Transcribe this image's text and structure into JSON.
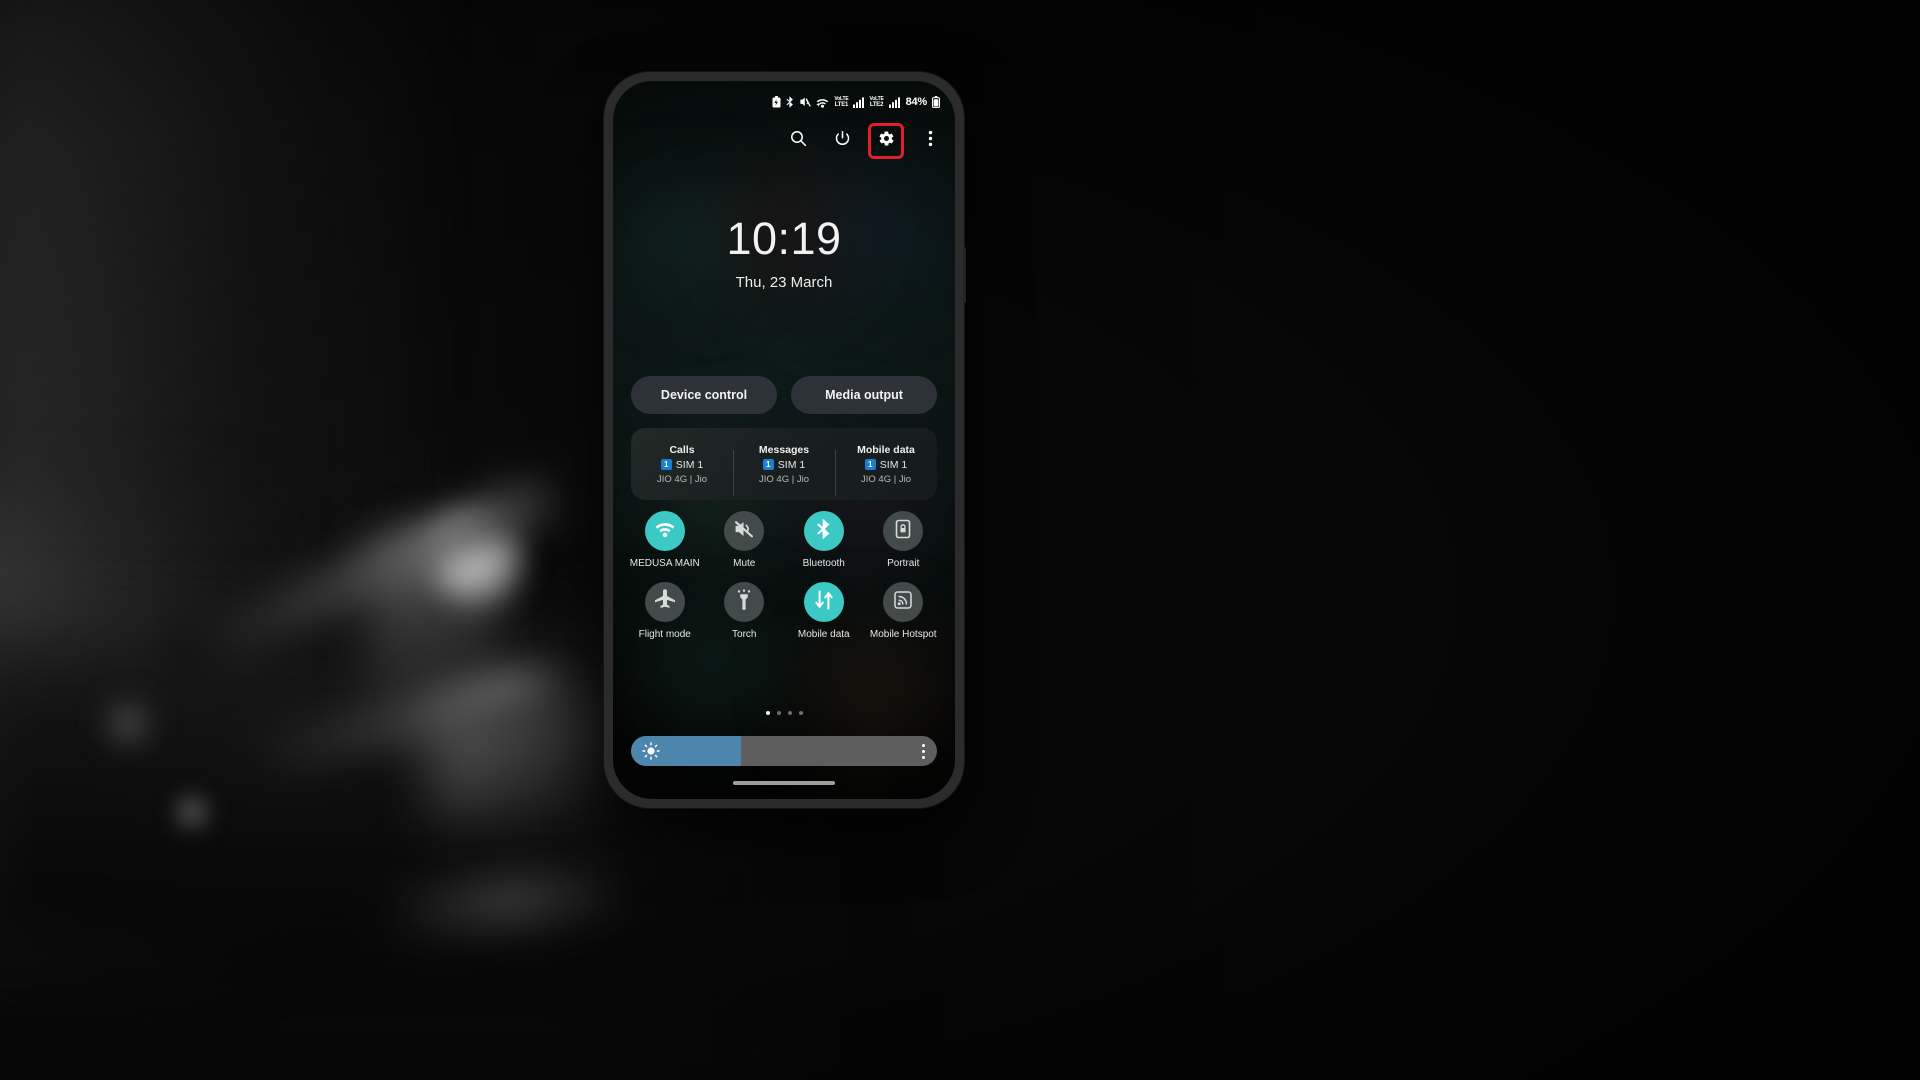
{
  "wallpaper": {
    "description": "blurred dark photo of a microphone on a desk"
  },
  "phone": {
    "status_bar": {
      "icons": [
        "battery-saver-icon",
        "bluetooth-icon",
        "mute-icon",
        "wifi-icon",
        "volte-sim1-icon",
        "signal-sim1-icon",
        "volte-sim2-icon",
        "signal-sim2-icon"
      ],
      "volte1_label_top": "VoLTE",
      "volte1_label_bottom": "LTE1",
      "volte2_label_top": "VoLTE",
      "volte2_label_bottom": "LTE2",
      "battery_percent": "84%"
    },
    "header": {
      "search_label": "Search",
      "power_label": "Power off",
      "settings_label": "Settings",
      "more_label": "More options",
      "highlight_color": "#e21f29",
      "highlighted_item": "settings-button"
    },
    "clock": {
      "time": "10:19",
      "date": "Thu, 23 March"
    },
    "quick_actions": [
      {
        "label": "Device control",
        "name": "device-control-button"
      },
      {
        "label": "Media output",
        "name": "media-output-button"
      }
    ],
    "sim_card": {
      "columns": [
        {
          "title": "Calls",
          "badge": "1",
          "sim": "SIM 1",
          "carrier": "JIO 4G | Jio"
        },
        {
          "title": "Messages",
          "badge": "1",
          "sim": "SIM 1",
          "carrier": "JIO 4G | Jio"
        },
        {
          "title": "Mobile data",
          "badge": "1",
          "sim": "SIM 1",
          "carrier": "JIO 4G | Jio"
        }
      ],
      "badge_color": "#1a7fd4"
    },
    "tiles": {
      "active_color": "#3cc9c6",
      "inactive_color": "#434b4a",
      "items": [
        {
          "label": "MEDUSA MAIN",
          "icon": "wifi-icon",
          "state": "on",
          "name": "tile-wifi"
        },
        {
          "label": "Mute",
          "icon": "mute-icon",
          "state": "off",
          "name": "tile-mute"
        },
        {
          "label": "Bluetooth",
          "icon": "bluetooth-icon",
          "state": "on",
          "name": "tile-bluetooth"
        },
        {
          "label": "Portrait",
          "icon": "rotation-lock-icon",
          "state": "off",
          "name": "tile-portrait"
        },
        {
          "label": "Flight mode",
          "icon": "airplane-icon",
          "state": "off",
          "name": "tile-flight-mode"
        },
        {
          "label": "Torch",
          "icon": "flashlight-icon",
          "state": "off",
          "name": "tile-torch"
        },
        {
          "label": "Mobile data",
          "icon": "data-transfer-icon",
          "state": "on",
          "name": "tile-mobile-data"
        },
        {
          "label": "Mobile Hotspot",
          "icon": "hotspot-icon",
          "state": "off",
          "name": "tile-mobile-hotspot"
        }
      ]
    },
    "pagination": {
      "pages": 4,
      "active_page": 1
    },
    "brightness": {
      "value_percent": 36,
      "fill_color": "#4d85ad",
      "track_color": "#5e5e5e",
      "menu_label": "Brightness options"
    }
  }
}
